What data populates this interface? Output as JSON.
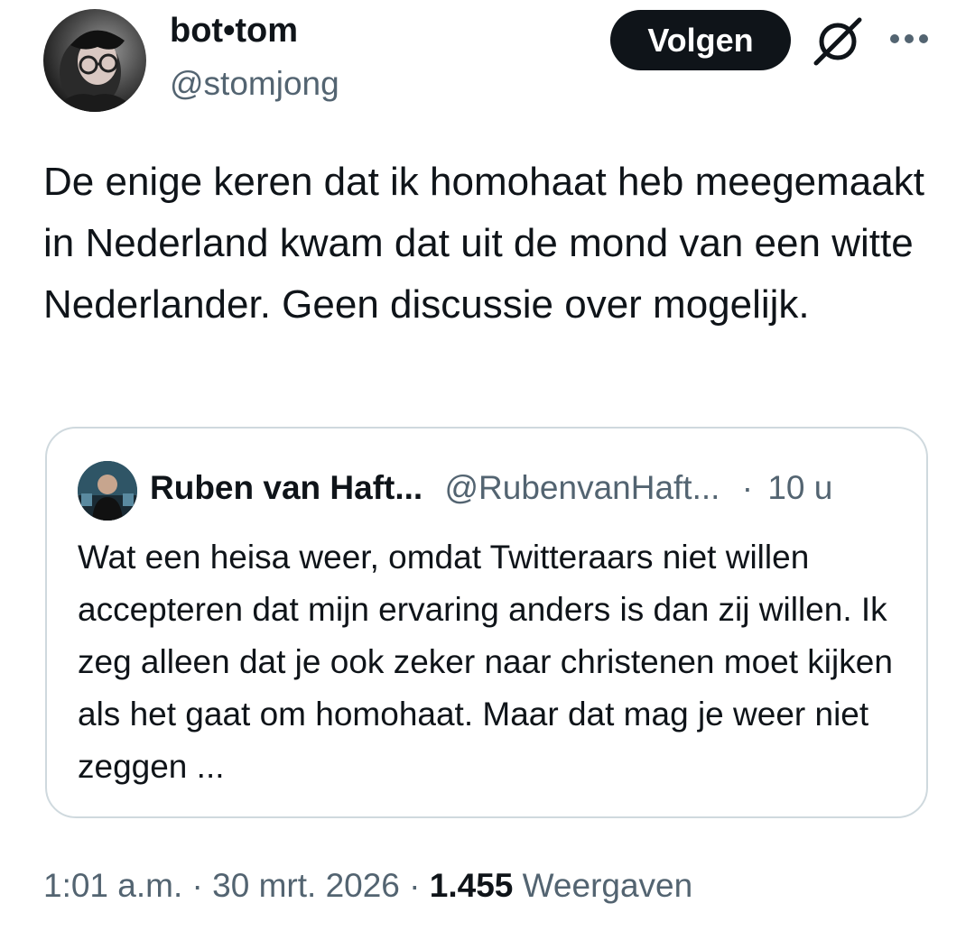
{
  "author": {
    "display_name": "bot•tom",
    "handle": "@stomjong",
    "follow_label": "Volgen",
    "avatar_icon": "profile-photo",
    "grok_icon": "grok-icon",
    "more_icon": "more-icon"
  },
  "tweet": {
    "text": "De enige keren dat ik homohaat heb meegemaakt in Nederland kwam dat uit de mond van een witte Nederlander. Geen discussie over mogelijk."
  },
  "quoted": {
    "display_name": "Ruben van Haft...",
    "handle": "@RubenvanHaft...",
    "separator": "·",
    "time": "10 u",
    "text": "Wat een heisa weer, omdat Twitteraars niet willen accepteren dat mijn ervaring anders is dan zij willen. Ik zeg alleen dat je ook zeker naar christenen moet kijken als het gaat om homohaat. Maar dat mag je weer niet zeggen ..."
  },
  "meta": {
    "time": "1:01 a.m.",
    "separator1": "·",
    "date": "30 mrt. 2026",
    "separator2": "·",
    "views_count": "1.455",
    "views_label": "Weergaven"
  },
  "colors": {
    "text_primary": "#0f1419",
    "text_secondary": "#536471",
    "border": "#cfd9de",
    "button_bg": "#0f1419",
    "button_text": "#ffffff"
  }
}
